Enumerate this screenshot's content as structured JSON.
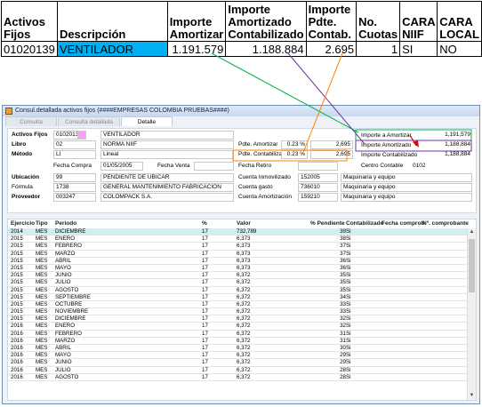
{
  "sheet": {
    "headers": [
      "Activos Fijos",
      "Descripción",
      "Importe Amortizar",
      "Importe Amortizado Contabilizado",
      "Importe Pdte. Contab.",
      "No. Cuotas",
      "CARA NIIF",
      "CARA LOCAL"
    ],
    "row": [
      "01020139",
      "VENTILADOR",
      "1.191.579",
      "1.188.884",
      "2.695",
      "1",
      "SI",
      "NO"
    ]
  },
  "window": {
    "title": "Consul.detallada activos fijos (####EMPRESAS COLOMBIA PRUEBAS####)",
    "tabs": [
      "Consulta",
      "Consulta detallada",
      "Detalle"
    ]
  },
  "form": {
    "activos_label": "Activos Fijos",
    "activos_code": "01020139",
    "activos_desc": "VENTILADOR",
    "libro_label": "Libro",
    "libro_code": "02",
    "libro_desc": "NORMA NIIF",
    "metodo_label": "Método",
    "metodo_code": "LI",
    "metodo_desc": "Lineal",
    "pdte_amortizar_label": "Pdte. Amortizar",
    "pdte_amortizar_pct": "0.23 %",
    "pdte_amortizar_val": "2,695",
    "pdte_contabilizar_label": "Pdte. Contabilizar",
    "pdte_contabilizar_pct": "0.23 %",
    "pdte_contabilizar_val": "2,695",
    "importe_amortizar_label": "Importe a Amortizar",
    "importe_amortizar_val": "1,191,579",
    "importe_amortizado_label": "Importe Amortizado",
    "importe_amortizado_val": "1,188,884",
    "importe_contabilizado_label": "Importe Contabilizado",
    "importe_contabilizado_val": "1,188,884",
    "fecha_compra_label": "Fecha Compra",
    "fecha_compra_val": "01/05/2005",
    "fecha_venta_label": "Fecha Venta",
    "fecha_venta_val": "",
    "fecha_retiro_label": "Fecha Retiro",
    "fecha_retiro_val": "",
    "centro_contable_label": "Centro Contable",
    "centro_contable_val": "0102",
    "ubicacion_label": "Ubicación",
    "ubicacion_code": "99",
    "ubicacion_desc": "PENDIENTE DE UBICAR",
    "formula_label": "Fórmula",
    "formula_code": "1738",
    "formula_desc": "GENERAL MANTENIMIENTO FABRICACION",
    "proveedor_label": "Proveedor",
    "proveedor_code": "003247",
    "proveedor_desc": "COLOMPACK S.A.",
    "cuenta_inmov_label": "Cuenta Inmovilizado",
    "cuenta_inmov_code": "152005",
    "cuenta_inmov_desc": "Maquinaria y equipo",
    "cuenta_gasto_label": "Cuenta gasto",
    "cuenta_gasto_code": "736010",
    "cuenta_gasto_desc": "Maquinaria y equipo",
    "cuenta_amort_label": "Cuenta Amortización",
    "cuenta_amort_code": "159210",
    "cuenta_amort_desc": "Maquinaria y equipo"
  },
  "grid": {
    "headers": {
      "ejercicio": "Ejercicio",
      "tipo": "Tipo",
      "periodo": "Periodo",
      "pct": "%",
      "valor": "Valor",
      "pct_pendiente": "% Pendiente",
      "contabilizado": "Contabilizado",
      "fecha_comprob": "Fecha comprob",
      "num_comprobante": "Nº. comprobante"
    },
    "rows": [
      [
        "2014",
        "MES",
        "DICIEMBRE",
        "17",
        "732,789",
        "39",
        "Si"
      ],
      [
        "2015",
        "MES",
        "ENERO",
        "17",
        "6,373",
        "38",
        "Si"
      ],
      [
        "2015",
        "MES",
        "FEBRERO",
        "17",
        "6,373",
        "37",
        "Si"
      ],
      [
        "2015",
        "MES",
        "MARZO",
        "17",
        "6,373",
        "37",
        "Si"
      ],
      [
        "2015",
        "MES",
        "ABRIL",
        "17",
        "6,373",
        "36",
        "Si"
      ],
      [
        "2015",
        "MES",
        "MAYO",
        "17",
        "6,373",
        "36",
        "Si"
      ],
      [
        "2015",
        "MES",
        "JUNIO",
        "17",
        "6,372",
        "35",
        "Si"
      ],
      [
        "2015",
        "MES",
        "JULIO",
        "17",
        "6,372",
        "35",
        "Si"
      ],
      [
        "2015",
        "MES",
        "AGOSTO",
        "17",
        "6,372",
        "35",
        "Si"
      ],
      [
        "2015",
        "MES",
        "SEPTIEMBRE",
        "17",
        "6,372",
        "34",
        "Si"
      ],
      [
        "2015",
        "MES",
        "OCTUBRE",
        "17",
        "6,372",
        "33",
        "Si"
      ],
      [
        "2015",
        "MES",
        "NOVIEMBRE",
        "17",
        "6,372",
        "33",
        "Si"
      ],
      [
        "2015",
        "MES",
        "DICIEMBRE",
        "17",
        "6,372",
        "32",
        "Si"
      ],
      [
        "2016",
        "MES",
        "ENERO",
        "17",
        "6,372",
        "32",
        "Si"
      ],
      [
        "2016",
        "MES",
        "FEBRERO",
        "17",
        "6,372",
        "31",
        "Si"
      ],
      [
        "2016",
        "MES",
        "MARZO",
        "17",
        "6,372",
        "31",
        "Si"
      ],
      [
        "2016",
        "MES",
        "ABRIL",
        "17",
        "6,372",
        "30",
        "Si"
      ],
      [
        "2016",
        "MES",
        "MAYO",
        "17",
        "6,372",
        "29",
        "Si"
      ],
      [
        "2016",
        "MES",
        "JUNIO",
        "17",
        "6,372",
        "29",
        "Si"
      ],
      [
        "2016",
        "MES",
        "JULIO",
        "17",
        "6,372",
        "28",
        "Si"
      ],
      [
        "2016",
        "MES",
        "AGOSTO",
        "17",
        "6,372",
        "28",
        "Si"
      ]
    ]
  },
  "colors": {
    "highlight_cell": "#00b0f0",
    "line_green": "#00b050",
    "line_purple": "#7030a0",
    "line_orange": "#ff8000",
    "arrow_red": "#e00000",
    "selected_row": "#cfeff0",
    "code_pink": "#ff99ff"
  }
}
